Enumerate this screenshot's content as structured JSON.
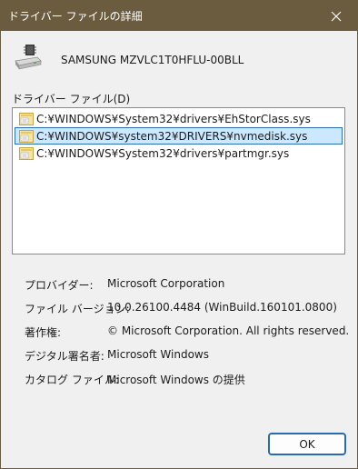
{
  "window": {
    "title": "ドライバー ファイルの詳細",
    "titlebar_color": "#6b5c3f"
  },
  "device": {
    "name": "SAMSUNG MZVLC1T0HFLU-00BLL",
    "icon": "drive-icon"
  },
  "driver_files": {
    "label": "ドライバー ファイル(D)",
    "selected_index": 1,
    "items": [
      {
        "path": "C:¥WINDOWS¥System32¥drivers¥EhStorClass.sys",
        "selected": false
      },
      {
        "path": "C:¥WINDOWS¥system32¥DRIVERS¥nvmedisk.sys",
        "selected": true
      },
      {
        "path": "C:¥WINDOWS¥System32¥drivers¥partmgr.sys",
        "selected": false
      }
    ]
  },
  "details": {
    "provider_label": "プロバイダー:",
    "provider_value": "Microsoft Corporation",
    "version_label": "ファイル バージョン:",
    "version_value": "10.0.26100.4484 (WinBuild.160101.0800)",
    "copyright_label": "著作権:",
    "copyright_value": "© Microsoft Corporation. All rights reserved.",
    "signer_label": "デジタル署名者:",
    "signer_value": "Microsoft Windows",
    "catalog_label": "カタログ ファイル:",
    "catalog_value": "Microsoft Windows の提供"
  },
  "buttons": {
    "ok_label": "OK"
  },
  "colors": {
    "selection_bg": "#cce8ff",
    "selection_border": "#2b6fb3",
    "ok_border": "#2a6bb0"
  }
}
